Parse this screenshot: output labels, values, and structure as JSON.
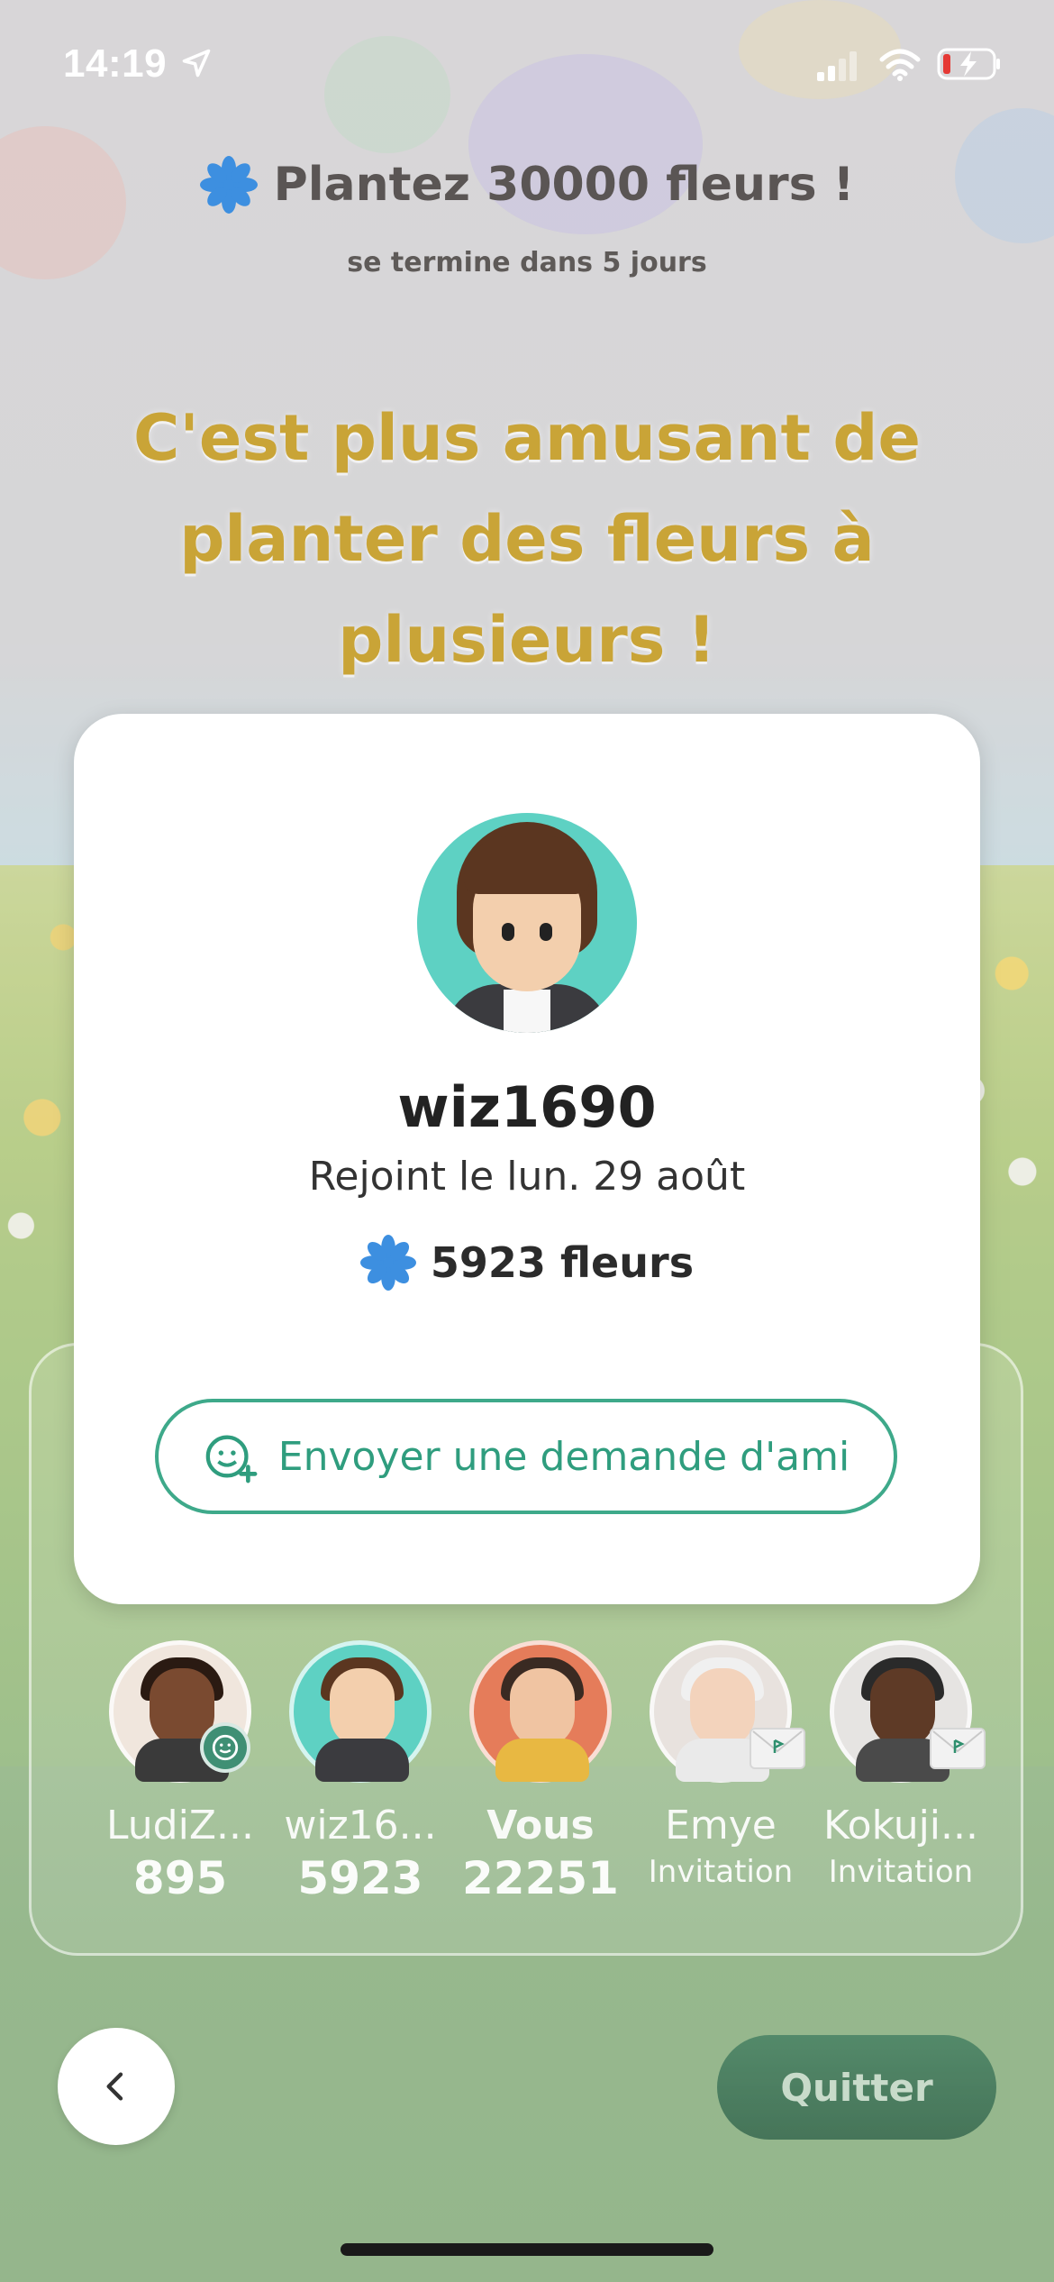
{
  "status_bar": {
    "time": "14:19",
    "icons": [
      "location-arrow-icon",
      "signal-icon",
      "wifi-icon",
      "battery-charging-icon"
    ]
  },
  "header": {
    "title": "Plantez 30000 fleurs !",
    "subtitle": "se termine dans 5 jours",
    "icon": "blue-flower-icon"
  },
  "tagline": "C'est plus amusant de planter des fleurs à plusieurs !",
  "profile_modal": {
    "username": "wiz1690",
    "joined": "Rejoint le lun. 29 août",
    "flowers": "5923 fleurs",
    "friend_request_label": "Envoyer une demande d'ami",
    "friend_request_icon": "add-friend-icon"
  },
  "friends": [
    {
      "name": "LudiZ...",
      "score": "895",
      "badge": "friend-badge-icon"
    },
    {
      "name": "wiz16...",
      "score": "5923"
    },
    {
      "name": "Vous",
      "score": "22251"
    },
    {
      "name": "Emye",
      "status": "Invitation",
      "badge": "mail-icon"
    },
    {
      "name": "Kokuji...",
      "status": "Invitation",
      "badge": "mail-icon"
    }
  ],
  "controls": {
    "back_icon": "chevron-left-icon",
    "quit_label": "Quitter"
  },
  "colors": {
    "accent_green": "#3ea98a",
    "tagline_gold": "#c9a437",
    "flower_blue": "#3d8fe0",
    "modal_bg": "#ffffff"
  }
}
